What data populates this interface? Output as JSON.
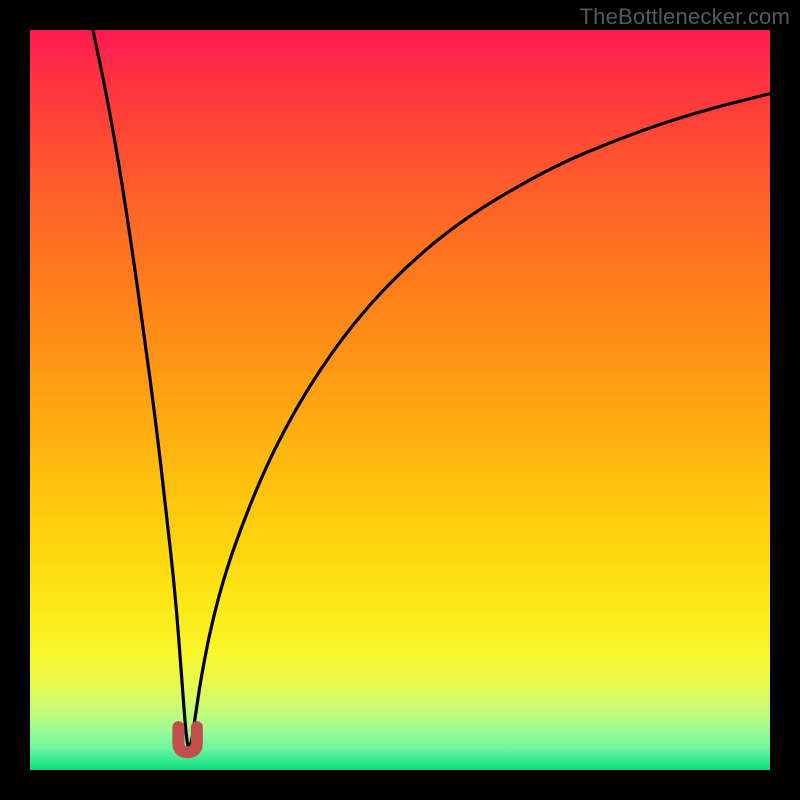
{
  "watermark": {
    "text": "TheBottlenecker.com"
  },
  "colors": {
    "frame": "#000000",
    "curve": "#000000",
    "marker_fill": "#c1504d",
    "marker_stroke": "#b24542",
    "gradient_top": "#ff1a50",
    "gradient_mid": "#ffd60e",
    "gradient_bottom": "#14d87a"
  },
  "chart_data": {
    "type": "line",
    "title": "",
    "xlabel": "",
    "ylabel": "",
    "x_range_pct": [
      0,
      100
    ],
    "y_range_pct": [
      0,
      100
    ],
    "series": [
      {
        "name": "bottleneck-curve",
        "description": "V-shaped bottleneck curve; left branch descends steeply from top, right branch rises with diminishing slope toward upper right. Minimum near x≈21%, y≈98%.",
        "x_pct": [
          8.5,
          10.2,
          12.0,
          13.7,
          15.4,
          17.0,
          18.4,
          19.6,
          20.4,
          20.9,
          21.3,
          21.7,
          22.3,
          23.2,
          24.6,
          26.5,
          29.0,
          31.9,
          35.2,
          38.8,
          42.7,
          46.9,
          51.4,
          56.1,
          61.1,
          66.5,
          72.2,
          78.4,
          84.9,
          92.0,
          100.0
        ],
        "y_pct": [
          0.0,
          8.0,
          18.0,
          29.0,
          41.0,
          53.0,
          65.0,
          76.0,
          86.0,
          93.0,
          97.0,
          97.0,
          93.0,
          87.0,
          80.0,
          73.0,
          66.0,
          59.0,
          52.5,
          46.5,
          41.0,
          36.0,
          31.5,
          27.5,
          24.0,
          20.8,
          17.8,
          15.2,
          12.8,
          10.6,
          8.6
        ]
      }
    ],
    "minimum_marker": {
      "shape": "u",
      "x_pct": 21.3,
      "y_pct_top": 94.2,
      "y_pct_bottom": 97.6,
      "half_width_pct": 1.25
    }
  }
}
